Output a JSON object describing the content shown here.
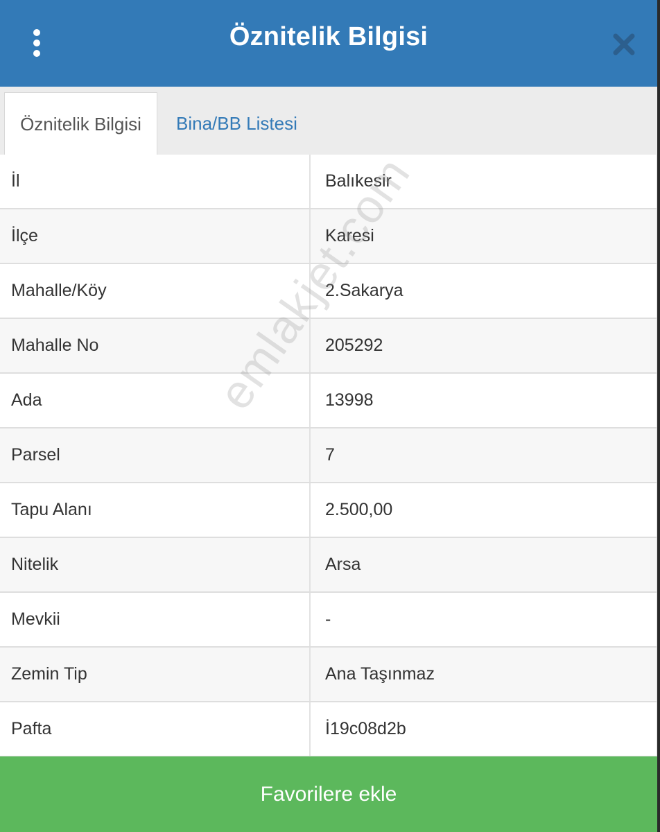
{
  "header": {
    "title": "Öznitelik Bilgisi",
    "menu_icon": "kebab-menu-icon",
    "close_icon": "close-icon",
    "color": "#337ab7"
  },
  "tabs": [
    {
      "label": "Öznitelik Bilgisi",
      "active": true
    },
    {
      "label": "Bina/BB Listesi",
      "active": false
    }
  ],
  "attributes": [
    {
      "key": "İl",
      "value": "Balıkesir"
    },
    {
      "key": "İlçe",
      "value": "Karesi"
    },
    {
      "key": "Mahalle/Köy",
      "value": "2.Sakarya"
    },
    {
      "key": "Mahalle No",
      "value": "205292"
    },
    {
      "key": "Ada",
      "value": "13998"
    },
    {
      "key": "Parsel",
      "value": "7"
    },
    {
      "key": "Tapu Alanı",
      "value": "2.500,00"
    },
    {
      "key": "Nitelik",
      "value": "Arsa"
    },
    {
      "key": "Mevkii",
      "value": "-"
    },
    {
      "key": "Zemin Tip",
      "value": "Ana Taşınmaz"
    },
    {
      "key": "Pafta",
      "value": "İ19c08d2b"
    }
  ],
  "watermark": "emlakjet.com",
  "footer": {
    "button_label": "Favorilere ekle",
    "color": "#5cb85c"
  }
}
